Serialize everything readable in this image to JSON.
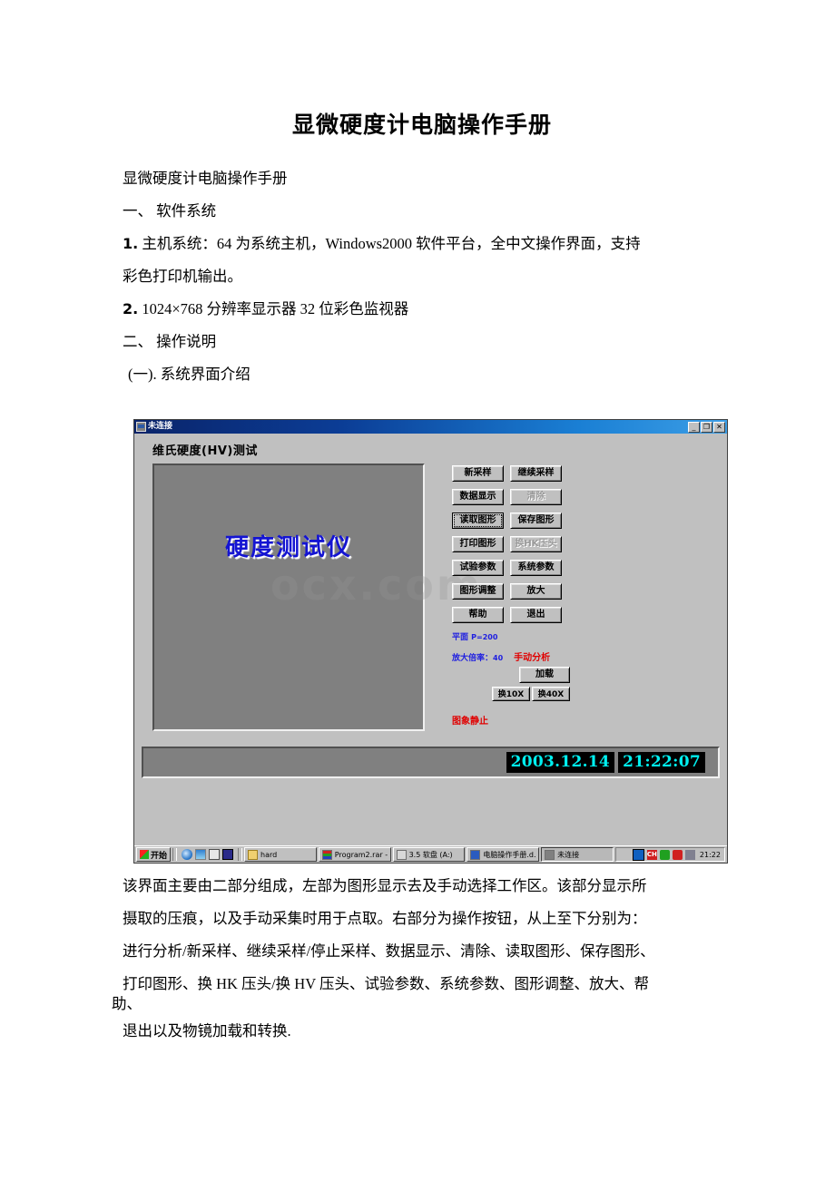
{
  "document": {
    "title": "显微硬度计电脑操作手册",
    "subtitle": "显微硬度计电脑操作手册",
    "section1_heading": "一、 软件系统",
    "item1_num": "1.",
    "item1_line1": "主机系统：64 为系统主机，Windows2000 软件平台，全中文操作界面，支持",
    "item1_line2": "彩色打印机输出。",
    "item2_num": "2.",
    "item2_text": "1024×768 分辨率显示器 32 位彩色监视器",
    "section2_heading": "二、 操作说明",
    "section2_sub": "(一). 系统界面介绍",
    "tail_line1": "该界面主要由二部分组成，左部为图形显示去及手动选择工作区。该部分显示所",
    "tail_line2": "摄取的压痕，以及手动采集时用于点取。右部分为操作按钮，从上至下分别为：",
    "tail_line3": "进行分析/新采样、继续采样/停止采样、数据显示、清除、读取图形、保存图形、",
    "tail_line4": "打印图形、换 HK 压头/换 HV 压头、试验参数、系统参数、图形调整、放大、帮",
    "tail_line5": "助、",
    "tail_line6": "退出以及物镜加载和转换."
  },
  "screenshot": {
    "titlebar": {
      "title": "未连接",
      "minimize": "_",
      "restore": "❐",
      "close": "✕"
    },
    "heading": "维氏硬度(HV)测试",
    "image_area": {
      "logo_text": "硬度测试仪"
    },
    "watermark": "ocx.com",
    "buttons": [
      {
        "label": "新采样",
        "state": "enabled"
      },
      {
        "label": "继续采样",
        "state": "enabled"
      },
      {
        "label": "数据显示",
        "state": "enabled"
      },
      {
        "label": "清除",
        "state": "disabled"
      },
      {
        "label": "读取图形",
        "state": "focused"
      },
      {
        "label": "保存图形",
        "state": "enabled"
      },
      {
        "label": "打印图形",
        "state": "enabled"
      },
      {
        "label": "换HK压头",
        "state": "disabled"
      },
      {
        "label": "试验参数",
        "state": "enabled"
      },
      {
        "label": "系统参数",
        "state": "enabled"
      },
      {
        "label": "图形调整",
        "state": "enabled"
      },
      {
        "label": "放大",
        "state": "enabled"
      },
      {
        "label": "帮助",
        "state": "enabled"
      },
      {
        "label": "退出",
        "state": "enabled"
      }
    ],
    "info": {
      "plane_label": "平面",
      "load_value": "P=200",
      "magnification_label": "放大倍率：",
      "magnification_value": "40",
      "manual_analysis": "手动分析",
      "load_button": "加载",
      "mag10_button": "换10X",
      "mag40_button": "换40X",
      "frozen_status": "图象静止"
    },
    "statusbar": {
      "date": "2003.12.14",
      "time": "21:22:07"
    },
    "taskbar": {
      "start_label": "开始",
      "tasks": [
        {
          "label": "hard",
          "icon": "folder-icon",
          "active": false
        },
        {
          "label": "Program2.rar -...",
          "icon": "winrar-icon",
          "active": false
        },
        {
          "label": "3.5 软盘 (A:)",
          "icon": "floppy-icon",
          "active": false
        },
        {
          "label": "电脑操作手册.d...",
          "icon": "word-icon",
          "active": false
        },
        {
          "label": "未连接",
          "icon": "app-icon",
          "active": true
        }
      ],
      "tray_time": "21:22",
      "tray_ch": "CH"
    }
  },
  "colors": {
    "accent_blue": "#1414d2",
    "status_red": "#e00000",
    "lcd_cyan": "#00f0f0",
    "window_gray": "#c0c0c0",
    "panel_gray": "#808080"
  }
}
